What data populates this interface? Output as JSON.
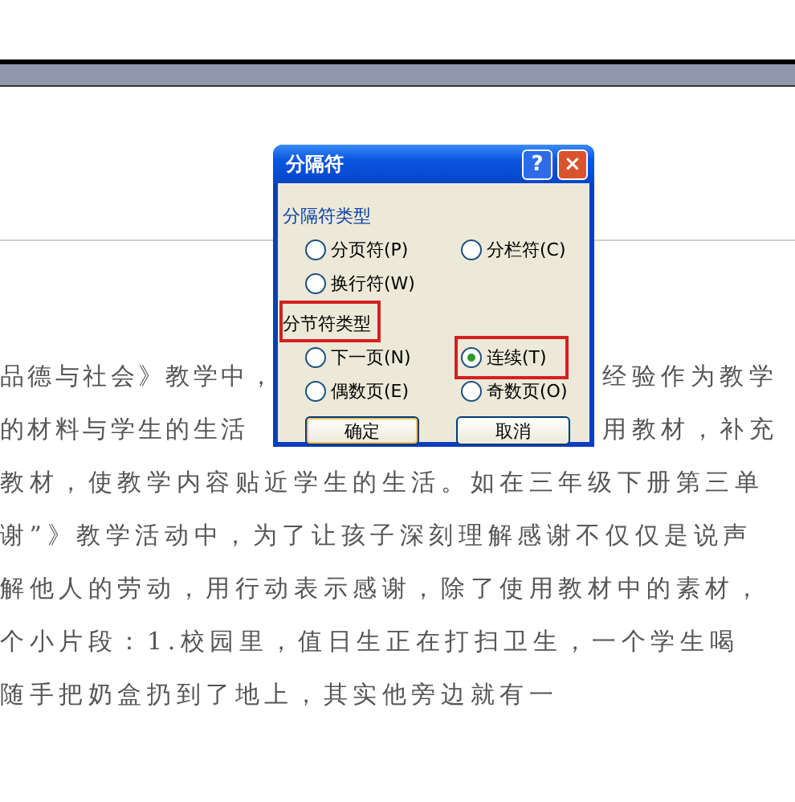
{
  "document": {
    "lines": [
      {
        "segments": [
          "品德与社会》教学中，",
          "经验作为教学"
        ]
      },
      {
        "segments": [
          "的材料与学生的生活",
          "用教材，补充"
        ]
      },
      {
        "segments": [
          "教材，使教学内容贴近学生的生活。如在三年级下册第三单"
        ]
      },
      {
        "segments": [
          "谢”》教学活动中，为了让孩子深刻理解感谢不仅仅是说声"
        ]
      },
      {
        "segments": [
          "解他人的劳动，用行动表示感谢，除了使用教材中的素材，"
        ]
      },
      {
        "segments": [
          "个小片段：1.校园里，值日生正在打扫卫生，一个学生喝"
        ]
      },
      {
        "segments": [
          "随手把奶盒扔到了地上，其实他旁边就有一"
        ]
      }
    ]
  },
  "dialog": {
    "title": "分隔符",
    "help_button": "?",
    "close_button": "×",
    "groups": [
      {
        "label": "分隔符类型",
        "highlighted": false,
        "options": [
          {
            "label": "分页符(P)",
            "selected": false,
            "highlighted": false
          },
          {
            "label": "分栏符(C)",
            "selected": false,
            "highlighted": false
          },
          {
            "label": "换行符(W)",
            "selected": false,
            "highlighted": false
          }
        ]
      },
      {
        "label": "分节符类型",
        "highlighted": true,
        "options": [
          {
            "label": "下一页(N)",
            "selected": false,
            "highlighted": false
          },
          {
            "label": "连续(T)",
            "selected": true,
            "highlighted": true
          },
          {
            "label": "偶数页(E)",
            "selected": false,
            "highlighted": false
          },
          {
            "label": "奇数页(O)",
            "selected": false,
            "highlighted": false
          }
        ]
      }
    ],
    "buttons": [
      "确定",
      "取消"
    ]
  }
}
